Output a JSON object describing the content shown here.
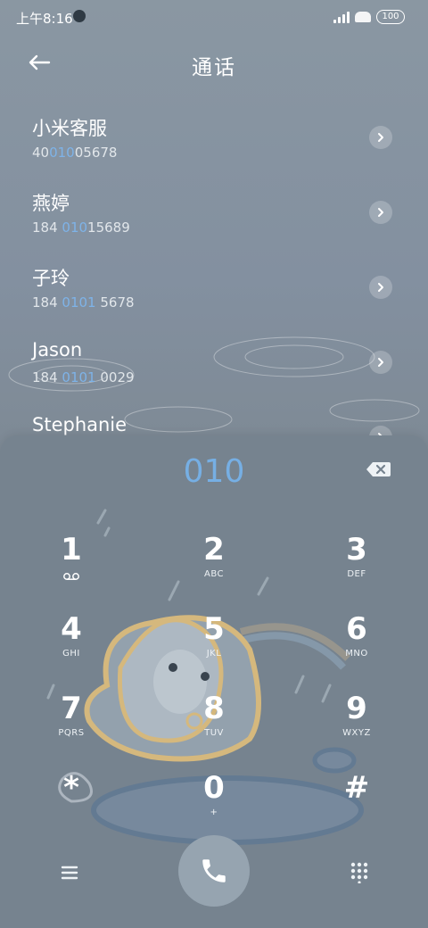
{
  "status": {
    "time": "上午8:16",
    "battery": "100"
  },
  "header": {
    "title": "通话"
  },
  "contacts": [
    {
      "name": "小米客服",
      "number_pre": "40",
      "number_hl": "010",
      "number_post": "05678"
    },
    {
      "name": "燕婷",
      "number_pre": "184 ",
      "number_hl": "010",
      "number_post": "15689"
    },
    {
      "name": "子玲",
      "number_pre": "184 ",
      "number_hl": "0101",
      "number_post": " 5678"
    },
    {
      "name": "Jason",
      "number_pre": "184 ",
      "number_hl": "0101",
      "number_post": " 0029"
    },
    {
      "name": "Stephanie",
      "number_pre": "",
      "number_hl": "",
      "number_post": ""
    }
  ],
  "dialer": {
    "input": "010",
    "keys": [
      {
        "digit": "1",
        "letters": "voicemail"
      },
      {
        "digit": "2",
        "letters": "ABC"
      },
      {
        "digit": "3",
        "letters": "DEF"
      },
      {
        "digit": "4",
        "letters": "GHI"
      },
      {
        "digit": "5",
        "letters": "JKL"
      },
      {
        "digit": "6",
        "letters": "MNO"
      },
      {
        "digit": "7",
        "letters": "PQRS"
      },
      {
        "digit": "8",
        "letters": "TUV"
      },
      {
        "digit": "9",
        "letters": "WXYZ"
      },
      {
        "digit": "*",
        "letters": ""
      },
      {
        "digit": "0",
        "letters": "+"
      },
      {
        "digit": "#",
        "letters": ""
      }
    ]
  },
  "colors": {
    "highlight": "#7eb3e8",
    "panel": "#76838f",
    "call_button": "#96a4b0"
  },
  "icons": {
    "back": "arrow-left-icon",
    "arrow": "chevron-right-icon",
    "backspace": "backspace-icon",
    "menu": "menu-icon",
    "call": "phone-icon",
    "keypad": "dialpad-icon"
  }
}
